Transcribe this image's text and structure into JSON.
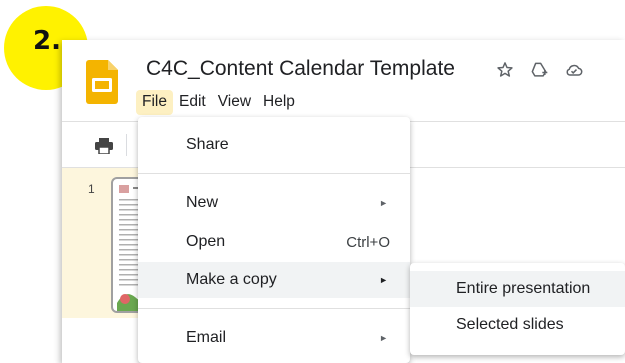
{
  "step_badge": "2.",
  "document": {
    "title": "C4C_Content Calendar Template"
  },
  "title_icons": [
    "star-icon",
    "move-to-drive-icon",
    "cloud-saved-icon"
  ],
  "menubar": {
    "items": [
      "File",
      "Edit",
      "View",
      "Help"
    ],
    "active": "File"
  },
  "toolbar": {
    "icons": [
      "print-icon"
    ]
  },
  "filmstrip": {
    "slide_number": "1"
  },
  "file_menu": {
    "share": "Share",
    "new": "New",
    "open": "Open",
    "open_shortcut": "Ctrl+O",
    "make_a_copy": "Make a copy",
    "email": "Email",
    "submenu_arrow": "►"
  },
  "copy_submenu": {
    "entire_presentation": "Entire presentation",
    "selected_slides": "Selected slides"
  },
  "colors": {
    "badge": "#fff200",
    "slides_logo": "#f4b400",
    "active_menu": "#fdf0c2",
    "menu_hover": "#f1f3f4",
    "filmstrip_selected": "#fdf6dd"
  }
}
